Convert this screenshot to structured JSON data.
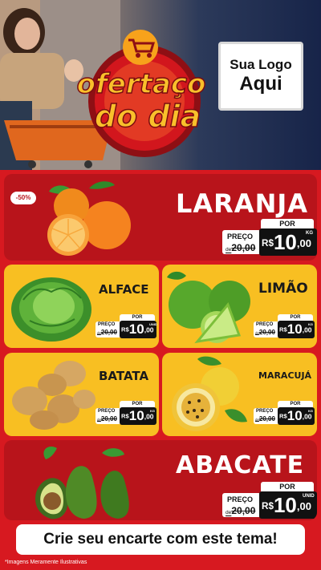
{
  "header": {
    "badge_line1": "ofertaço",
    "badge_line2": "do dia",
    "logo_line1": "Sua Logo",
    "logo_line2": "Aqui"
  },
  "discount_badge": "-50%",
  "products": [
    {
      "name": "LARANJA",
      "por": "POR",
      "preco": "PREÇO",
      "old_prefix": "de",
      "old_value": "20,00",
      "currency": "R$",
      "price_int": "10",
      "price_cents": ",00",
      "unit": "KG"
    },
    {
      "name": "ALFACE",
      "por": "POR",
      "preco": "PREÇO",
      "old_prefix": "de",
      "old_value": "20,00",
      "currency": "R$",
      "price_int": "10",
      "price_cents": ",00",
      "unit": "UNID"
    },
    {
      "name": "LIMÃO",
      "por": "POR",
      "preco": "PREÇO",
      "old_prefix": "de",
      "old_value": "20,00",
      "currency": "R$",
      "price_int": "10",
      "price_cents": ",00",
      "unit": "KG"
    },
    {
      "name": "BATATA",
      "por": "POR",
      "preco": "PREÇO",
      "old_prefix": "de",
      "old_value": "20,00",
      "currency": "R$",
      "price_int": "10",
      "price_cents": ",00",
      "unit": "KG"
    },
    {
      "name": "MARACUJÁ",
      "por": "POR",
      "preco": "PREÇO",
      "old_prefix": "de",
      "old_value": "20,00",
      "currency": "R$",
      "price_int": "10",
      "price_cents": ",00",
      "unit": "KG"
    },
    {
      "name": "ABACATE",
      "por": "POR",
      "preco": "PREÇO",
      "old_prefix": "de",
      "old_value": "20,00",
      "currency": "R$",
      "price_int": "10",
      "price_cents": ",00",
      "unit": "UNID"
    }
  ],
  "footer": {
    "cta": "Crie seu encarte com este tema!",
    "disclaimer": "*Imagens Meramente Ilustrativas"
  },
  "colors": {
    "red": "#d71920",
    "dark_red": "#b8141b",
    "yellow": "#f8bf22",
    "navy": "#172449"
  },
  "icons": [
    "shopping-cart-icon",
    "orange-image",
    "lettuce-image",
    "lime-image",
    "potato-image",
    "passion-fruit-image",
    "avocado-image"
  ]
}
